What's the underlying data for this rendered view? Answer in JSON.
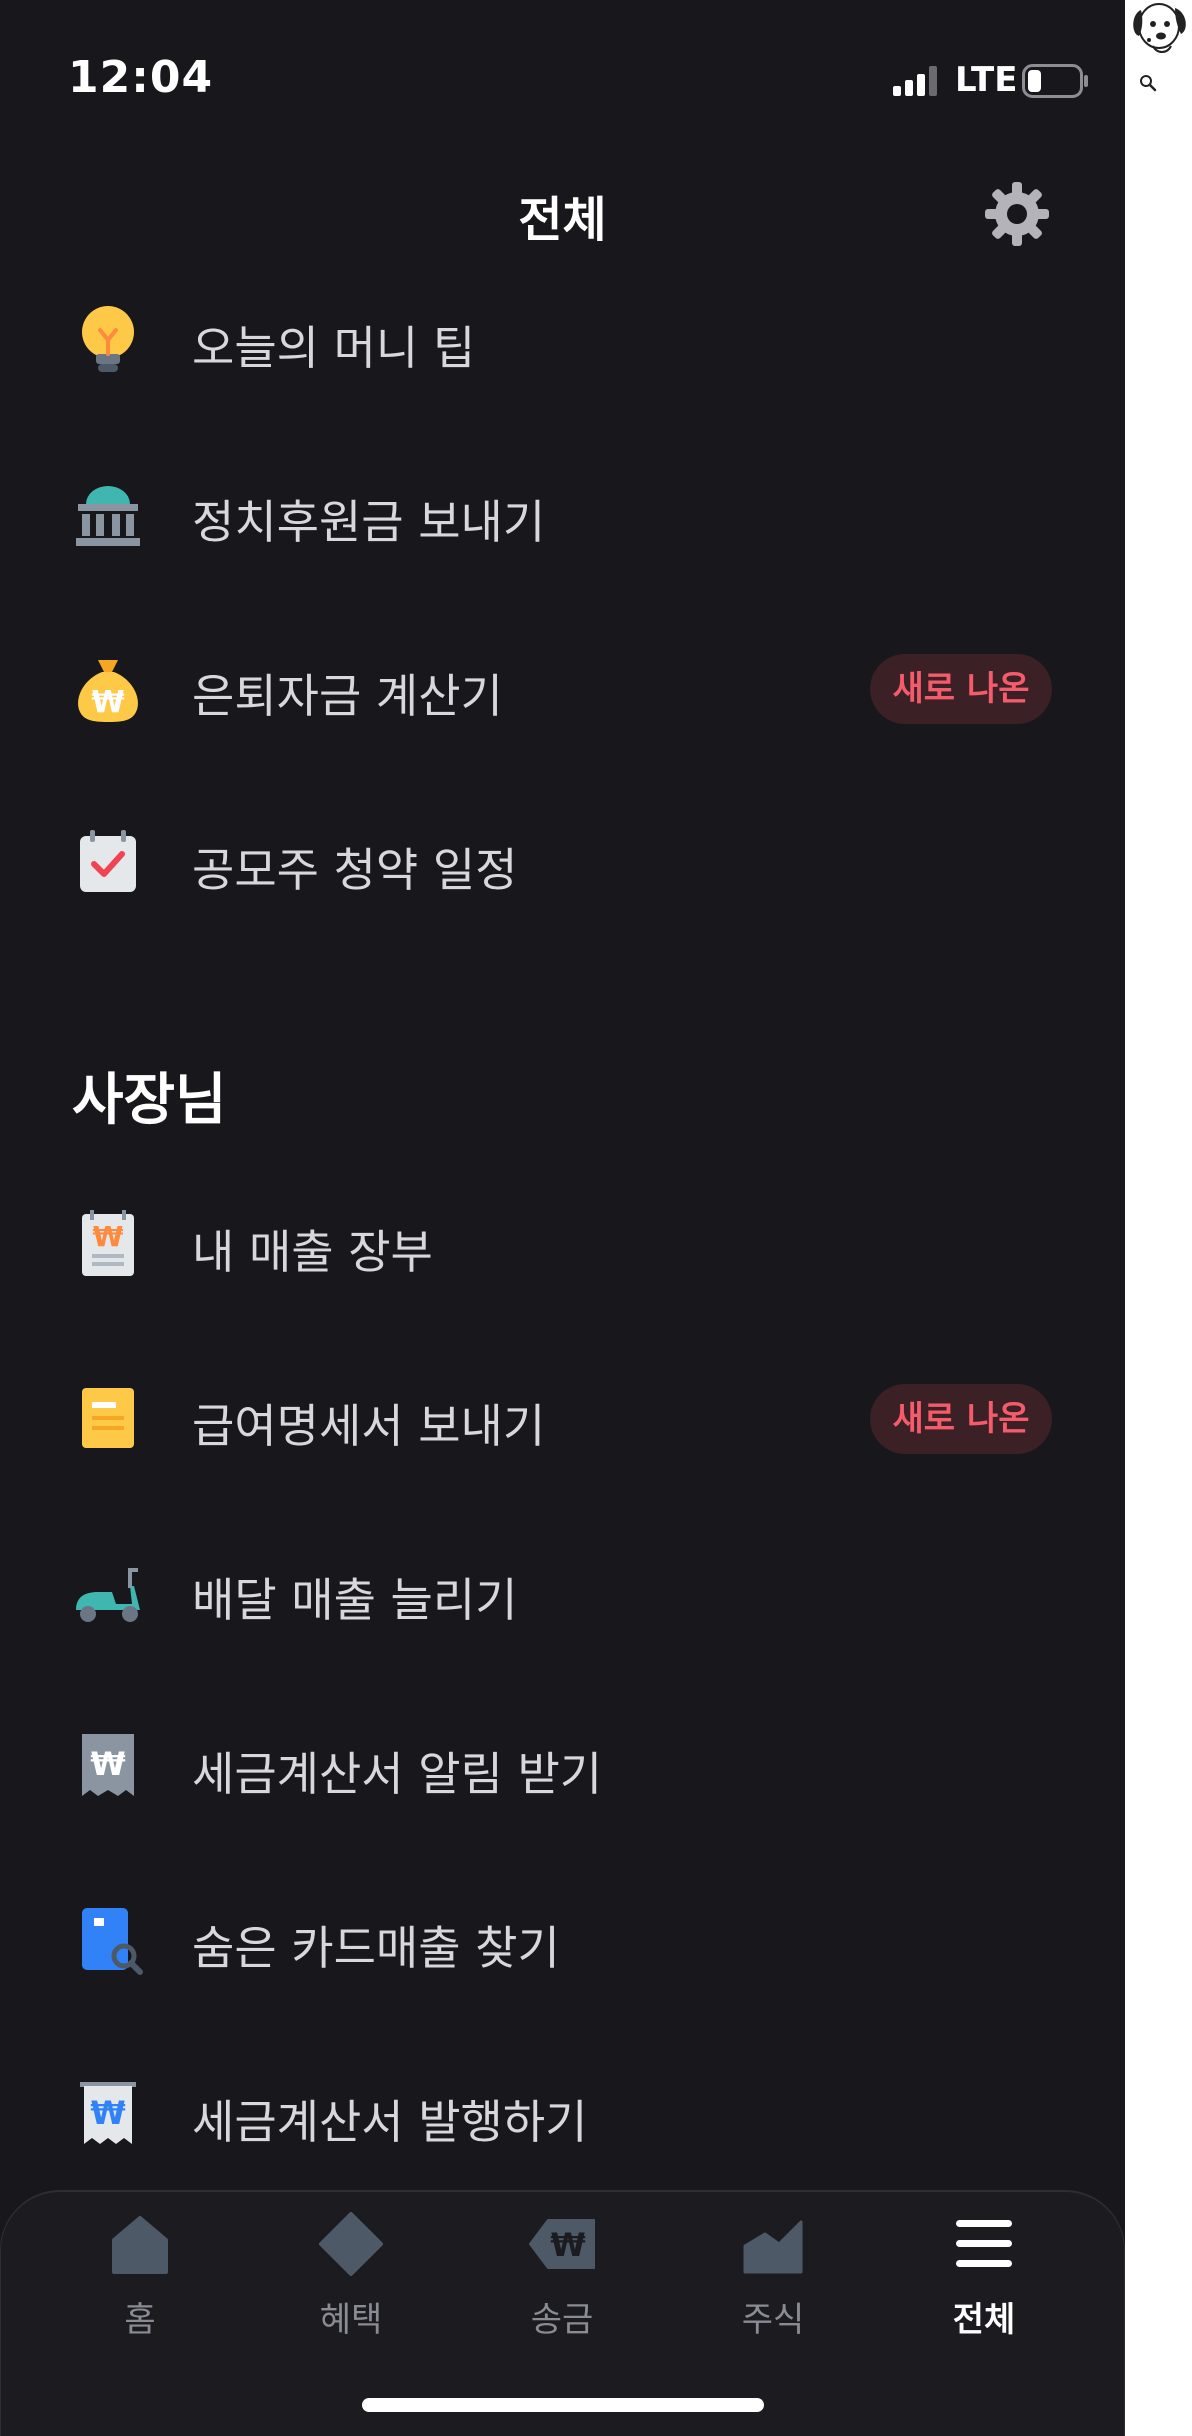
{
  "status": {
    "time": "12:04",
    "network": "LTE"
  },
  "header": {
    "title": "전체"
  },
  "items": [
    {
      "label": "오늘의 머니 팁",
      "icon": "lightbulb-icon"
    },
    {
      "label": "정치후원금 보내기",
      "icon": "bank-icon"
    },
    {
      "label": "은퇴자금 계산기",
      "icon": "money-bag-icon",
      "badge": "새로 나온"
    },
    {
      "label": "공모주 청약 일정",
      "icon": "calendar-check-icon"
    }
  ],
  "owner_section": {
    "title": "사장님",
    "items": [
      {
        "label": "내 매출 장부",
        "icon": "ledger-won-icon"
      },
      {
        "label": "급여명세서 보내기",
        "icon": "payslip-icon",
        "badge": "새로 나온"
      },
      {
        "label": "배달 매출 늘리기",
        "icon": "scooter-icon"
      },
      {
        "label": "세금계산서 알림 받기",
        "icon": "tax-invoice-icon"
      },
      {
        "label": "숨은 카드매출 찾기",
        "icon": "card-search-icon"
      },
      {
        "label": "세금계산서 발행하기",
        "icon": "invoice-issue-icon"
      }
    ]
  },
  "tabs": [
    {
      "label": "홈",
      "icon": "home-icon"
    },
    {
      "label": "혜택",
      "icon": "diamond-icon"
    },
    {
      "label": "송금",
      "icon": "won-transfer-icon"
    },
    {
      "label": "주식",
      "icon": "stock-chart-icon"
    },
    {
      "label": "전체",
      "icon": "menu-icon",
      "active": true
    }
  ],
  "colors": {
    "background": "#17171c",
    "badge_text": "#f45b6b",
    "badge_bg": "#3b2026",
    "text": "#d7d7dc"
  }
}
